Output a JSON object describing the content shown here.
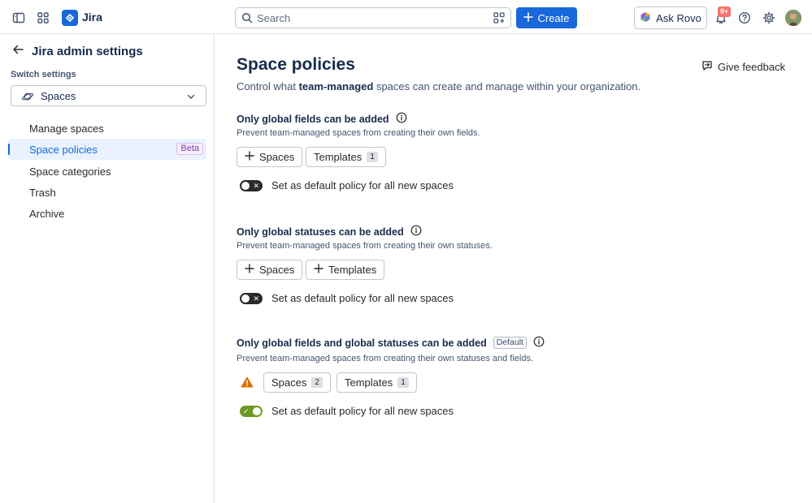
{
  "topbar": {
    "app_name": "Jira",
    "search_placeholder": "Search",
    "create_label": "Create",
    "ask_rovo_label": "Ask Rovo",
    "notification_count": "9+"
  },
  "sidebar": {
    "title": "Jira admin settings",
    "switch_label": "Switch settings",
    "switch_value": "Spaces",
    "items": [
      {
        "label": "Manage spaces"
      },
      {
        "label": "Space policies",
        "badge": "Beta"
      },
      {
        "label": "Space categories"
      },
      {
        "label": "Trash"
      },
      {
        "label": "Archive"
      }
    ]
  },
  "main": {
    "title": "Space policies",
    "feedback_label": "Give feedback",
    "description_pre": "Control what ",
    "description_bold": "team-managed",
    "description_post": " spaces can create and manage within your organization.",
    "policies": [
      {
        "title": "Only global fields can be added",
        "description": "Prevent team-managed spaces from creating their own fields.",
        "spaces_label": "Spaces",
        "templates_label": "Templates",
        "templates_count": "1",
        "toggle_label": "Set as default policy for all new spaces",
        "toggle_on": false
      },
      {
        "title": "Only global statuses can be added",
        "description": "Prevent team-managed spaces from creating their own statuses.",
        "spaces_label": "Spaces",
        "templates_label": "Templates",
        "toggle_label": "Set as default policy for all new spaces",
        "toggle_on": false
      },
      {
        "title": "Only global fields and global statuses can be added",
        "badge": "Default",
        "description": "Prevent team-managed spaces from creating their own statuses and fields.",
        "spaces_label": "Spaces",
        "spaces_count": "2",
        "templates_label": "Templates",
        "templates_count": "1",
        "toggle_label": "Set as default policy for all new spaces",
        "toggle_on": true
      }
    ]
  },
  "colors": {
    "brand_blue": "#1868db",
    "toggle_on": "#6a9a23",
    "toggle_off": "#292a2e",
    "warning": "#e06c00"
  }
}
